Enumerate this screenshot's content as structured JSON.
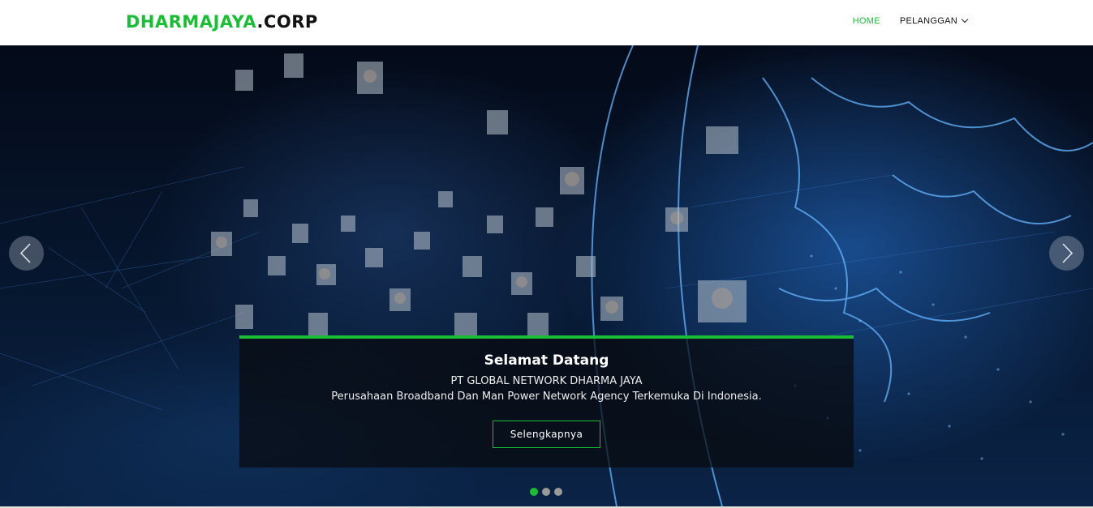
{
  "brand": {
    "part1": "DHARMAJAYA",
    "part2": ".CORP",
    "accent": "#1bbd36"
  },
  "nav": {
    "items": [
      {
        "label": "HOME",
        "active": true
      },
      {
        "label": "PELANGGAN",
        "dropdown": true
      }
    ]
  },
  "hero": {
    "title": "Selamat Datang",
    "line1": "PT GLOBAL NETWORK DHARMA JAYA",
    "line2": "Perusahaan Broadband Dan Man Power Network Agency Terkemuka Di Indonesia.",
    "cta_label": "Selengkapnya",
    "slides": 3,
    "active_slide": 1
  },
  "icons": {
    "prev": "chevron-left-icon",
    "next": "chevron-right-icon",
    "dropdown": "chevron-down-icon"
  }
}
